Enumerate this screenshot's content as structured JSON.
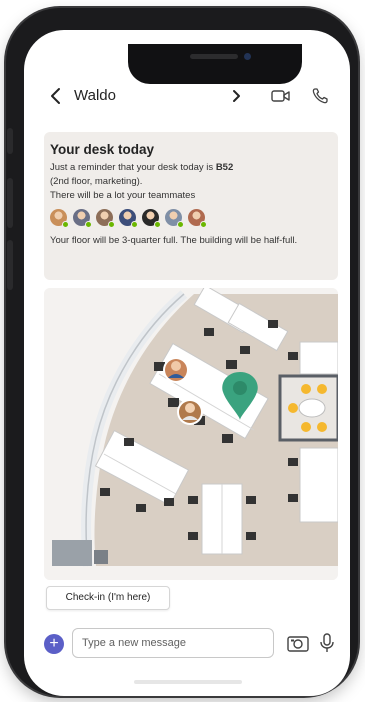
{
  "chat": {
    "contact_name": "Waldo"
  },
  "message": {
    "title": "Your desk today",
    "line1_prefix": "Just a reminder that your desk today is ",
    "desk_id": "B52",
    "line2": "(2nd floor, marketing).",
    "line3": "There will be a lot your teammates",
    "teammates": [
      {
        "name": "teammate-1",
        "color": "#c98f5a"
      },
      {
        "name": "teammate-2",
        "color": "#6a6f86"
      },
      {
        "name": "teammate-3",
        "color": "#8d6e58"
      },
      {
        "name": "teammate-4",
        "color": "#3d4e7a"
      },
      {
        "name": "teammate-5",
        "color": "#2a2a2a"
      },
      {
        "name": "teammate-6",
        "color": "#7f8fa6"
      },
      {
        "name": "teammate-7",
        "color": "#b06a4f"
      }
    ],
    "occupancy_text": "Your floor will be 3-quarter full. The building will be half-full."
  },
  "actions": {
    "checkin_label": "Check-in (I'm here)"
  },
  "composer": {
    "placeholder": "Type a new message"
  },
  "colors": {
    "accent": "#5b5fc7",
    "pin": "#3aa37f",
    "presence": "#6bb700",
    "card_bg": "#f0edea",
    "floor": "#d9cfc4"
  },
  "icons": [
    "back-chevron-icon",
    "forward-chevron-icon",
    "video-call-icon",
    "phone-call-icon",
    "add-icon",
    "camera-icon",
    "microphone-icon",
    "location-pin-icon"
  ]
}
